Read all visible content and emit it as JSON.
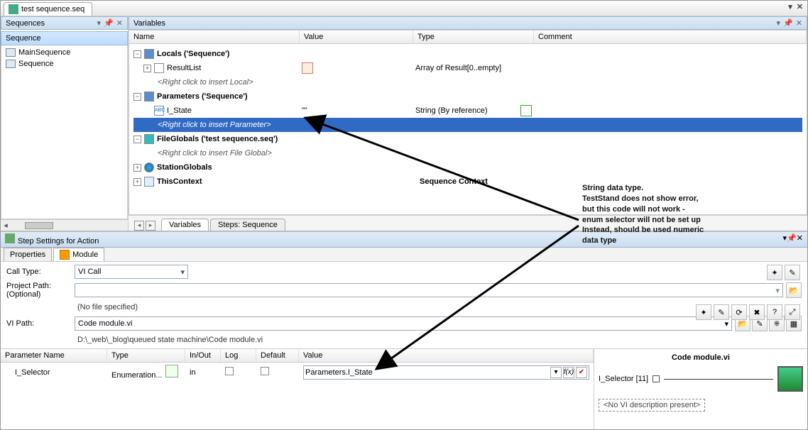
{
  "top_tab": {
    "label": "test sequence.seq"
  },
  "sequences_panel": {
    "title": "Sequences",
    "column": "Sequence",
    "items": [
      "MainSequence",
      "Sequence"
    ]
  },
  "variables_panel": {
    "title": "Variables",
    "columns": {
      "name": "Name",
      "value": "Value",
      "type": "Type",
      "comment": "Comment"
    },
    "nodes": {
      "locals": {
        "label": "Locals ('Sequence')"
      },
      "resultlist": {
        "label": "ResultList",
        "type": "Array of Result[0..empty]"
      },
      "locals_hint": "<Right click to insert Local>",
      "params": {
        "label": "Parameters ('Sequence')"
      },
      "istate": {
        "label": "I_State",
        "value": "\"\"",
        "type": "String (By reference)"
      },
      "params_hint": "<Right click to insert Parameter>",
      "fileglobals": {
        "label": "FileGlobals ('test sequence.seq')"
      },
      "fg_hint": "<Right click to insert File Global>",
      "stationglobals": {
        "label": "StationGlobals"
      },
      "thiscontext": {
        "label": "ThisContext",
        "type": "Sequence Context"
      }
    },
    "bottom_tabs": {
      "active": "Variables",
      "other": "Steps: Sequence"
    }
  },
  "step_settings": {
    "title": "Step Settings for Action",
    "tabs": {
      "properties": "Properties",
      "module": "Module"
    },
    "labels": {
      "call_type": "Call Type:",
      "project_path": "Project Path:",
      "optional": "(Optional)",
      "vi_path": "VI Path:"
    },
    "values": {
      "call_type": "VI Call",
      "project_placeholder": "(No file specified)",
      "vi_path": "Code module.vi",
      "vi_full": "D:\\_web\\_blog\\queued state machine\\Code module.vi"
    },
    "param_cols": {
      "name": "Parameter Name",
      "type": "Type",
      "io": "In/Out",
      "log": "Log",
      "def": "Default",
      "val": "Value"
    },
    "param_row": {
      "name": "I_Selector",
      "type": "Enumeration...",
      "io": "in",
      "val": "Parameters.I_State"
    },
    "preview": {
      "title": "Code module.vi",
      "conn": "I_Selector [11]",
      "nodesc": "<No VI description present>"
    }
  },
  "annotation": {
    "l1": "String data type.",
    "l2": "TestStand does not show error,",
    "l3": "but this code will not work -",
    "l4": "enum selector will not be set up",
    "l5": "Instead, should be used numeric",
    "l6": "data type"
  }
}
